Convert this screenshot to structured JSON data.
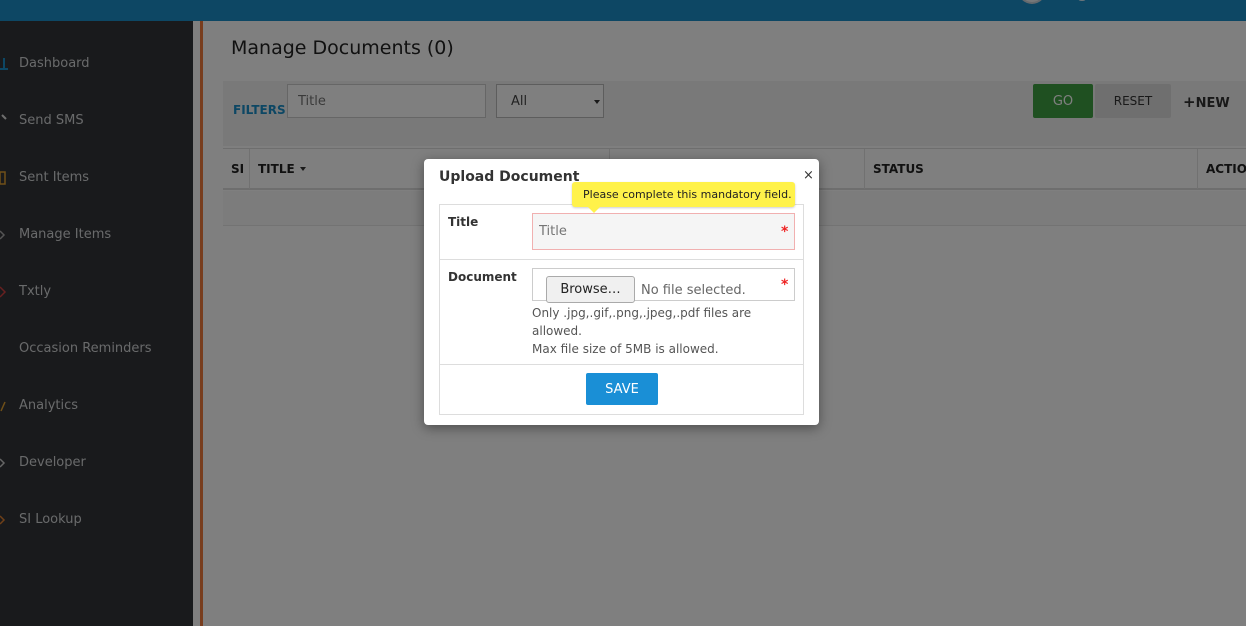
{
  "sidebar": {
    "items": [
      {
        "label": "Dashboard",
        "icon": "dashboard-icon"
      },
      {
        "label": "Send SMS",
        "icon": "send-sms-icon"
      },
      {
        "label": "Sent Items",
        "icon": "sent-items-icon"
      },
      {
        "label": "Manage Items",
        "icon": "manage-items-icon"
      },
      {
        "label": "Txtly",
        "icon": "txtly-icon"
      },
      {
        "label": "Occasion Reminders",
        "icon": "reminders-icon"
      },
      {
        "label": "Analytics",
        "icon": "analytics-icon"
      },
      {
        "label": "Developer",
        "icon": "developer-icon"
      },
      {
        "label": "SI Lookup",
        "icon": "lookup-icon"
      }
    ]
  },
  "page": {
    "title": "Manage Documents (0)"
  },
  "filters": {
    "label": "FILTERS",
    "title_placeholder": "Title",
    "select_value": "All",
    "go_label": "GO",
    "reset_label": "RESET",
    "new_label": "NEW"
  },
  "table": {
    "columns": [
      "SI",
      "TITLE",
      "STATUS",
      "ACTION"
    ]
  },
  "modal": {
    "title": "Upload Document",
    "close_label": "×",
    "title_label": "Title",
    "title_placeholder": "Title",
    "document_label": "Document",
    "browse_label": "Browse…",
    "no_file_text": "No file selected.",
    "help_formats": "Only .jpg,.gif,.png,.jpeg,.pdf files are allowed.",
    "help_size": "Max file size of 5MB is allowed.",
    "required_mark": "*",
    "save_label": "SAVE",
    "tooltip": "Please complete this mandatory field."
  },
  "colors": {
    "topbar": "#1a8fc9",
    "sidebar": "#333538",
    "accent_bar": "#f07a3c",
    "go_button": "#3fa142",
    "save_button": "#1a8fd6",
    "tooltip": "#fff24a"
  }
}
